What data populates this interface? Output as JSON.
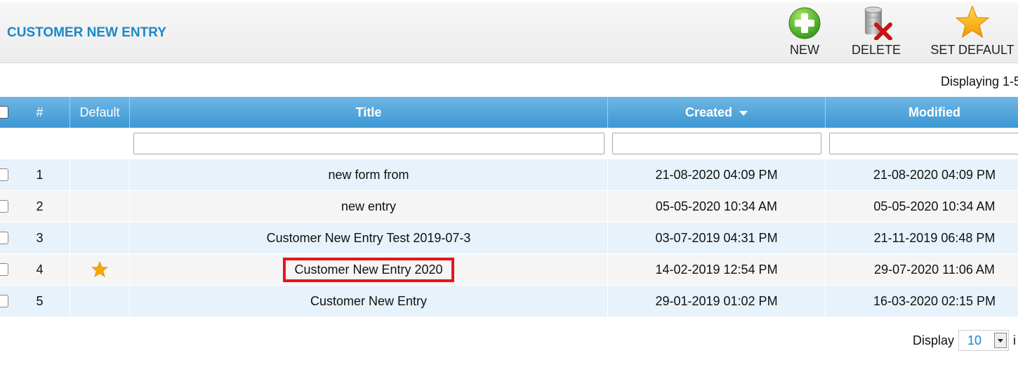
{
  "header": {
    "title": "CUSTOMER NEW ENTRY"
  },
  "toolbar": {
    "new_label": "NEW",
    "delete_label": "DELETE",
    "set_default_label": "SET DEFAULT"
  },
  "pagination": {
    "displaying_text": "Displaying 1-5",
    "display_label": "Display",
    "page_size": "10",
    "trailing_text": "i"
  },
  "table": {
    "columns": {
      "num": "#",
      "default": "Default",
      "title": "Title",
      "created": "Created",
      "modified": "Modified"
    },
    "sort_column": "Created",
    "sort_direction": "desc",
    "rows": [
      {
        "num": "1",
        "is_default": false,
        "title": "new form from",
        "created": "21-08-2020 04:09 PM",
        "modified": "21-08-2020 04:09 PM"
      },
      {
        "num": "2",
        "is_default": false,
        "title": "new entry",
        "created": "05-05-2020 10:34 AM",
        "modified": "05-05-2020 10:34 AM"
      },
      {
        "num": "3",
        "is_default": false,
        "title": "Customer New Entry Test 2019-07-3",
        "created": "03-07-2019 04:31 PM",
        "modified": "21-11-2019 06:48 PM"
      },
      {
        "num": "4",
        "is_default": true,
        "title": "Customer New Entry 2020",
        "created": "14-02-2019 12:54 PM",
        "modified": "29-07-2020 11:06 AM",
        "highlighted": true
      },
      {
        "num": "5",
        "is_default": false,
        "title": "Customer New Entry",
        "created": "29-01-2019 01:02 PM",
        "modified": "16-03-2020 02:15 PM"
      }
    ]
  },
  "colors": {
    "title_blue": "#1b87c9",
    "header_blue": "#3d97d3",
    "highlight_red": "#e8141b",
    "star_gold": "#f5a800"
  },
  "icons": {
    "new": "plus-circle-icon",
    "delete": "database-delete-icon",
    "set_default": "star-icon",
    "default_marker": "star-icon"
  }
}
